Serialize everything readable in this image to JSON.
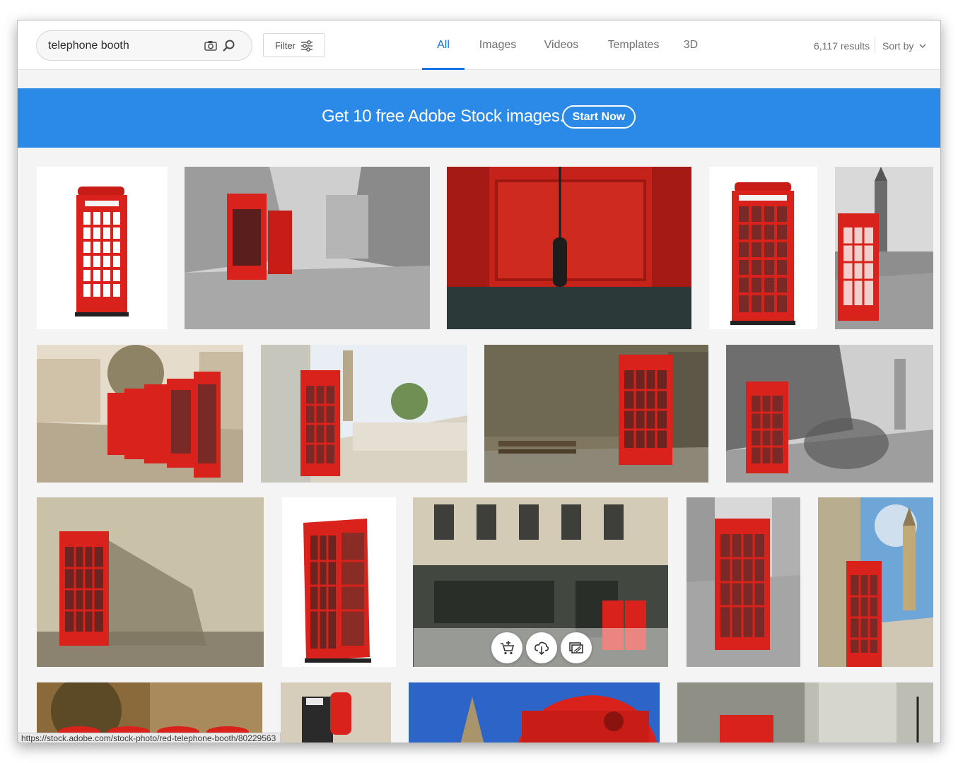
{
  "search": {
    "value": "telephone booth",
    "placeholder": "Search"
  },
  "filter": {
    "label": "Filter"
  },
  "tabs": [
    {
      "label": "All",
      "active": true
    },
    {
      "label": "Images",
      "active": false
    },
    {
      "label": "Videos",
      "active": false
    },
    {
      "label": "Templates",
      "active": false
    },
    {
      "label": "3D",
      "active": false
    }
  ],
  "results": {
    "count": "6,117 results"
  },
  "sort": {
    "label": "Sort by"
  },
  "banner": {
    "text": "Get 10 free Adobe Stock images.",
    "button": "Start Now",
    "color": "#2b89e8"
  },
  "colors": {
    "accent": "#1473e6",
    "booth_red": "#d9221b"
  },
  "thumbnails": [
    "red telephone booth on white",
    "two red phone booths in London street",
    "red phone booth interior with hanging receiver",
    "red telephone booth isolated",
    "red phone booth with Big Ben black and white",
    "row of red phone booths in rain",
    "red phone booth on bridge walkway",
    "red phone booth with wooden bench",
    "red phone booth with blurred crowd",
    "red phone booth against concrete wall",
    "red telephone box isolated",
    "two red phone booths by building",
    "red phone booth on sidewalk",
    "red phone booth with Big Ben blue sky",
    "row of red phone booths in courtyard",
    "red phone close-up",
    "red phone booth roof with crown",
    "red phone booth in street with lamp"
  ],
  "hover_actions": [
    {
      "icon": "add-to-cart-icon"
    },
    {
      "icon": "cloud-download-icon"
    },
    {
      "icon": "find-similar-icon"
    }
  ],
  "status_url": "https://stock.adobe.com/stock-photo/red-telephone-booth/80229563"
}
